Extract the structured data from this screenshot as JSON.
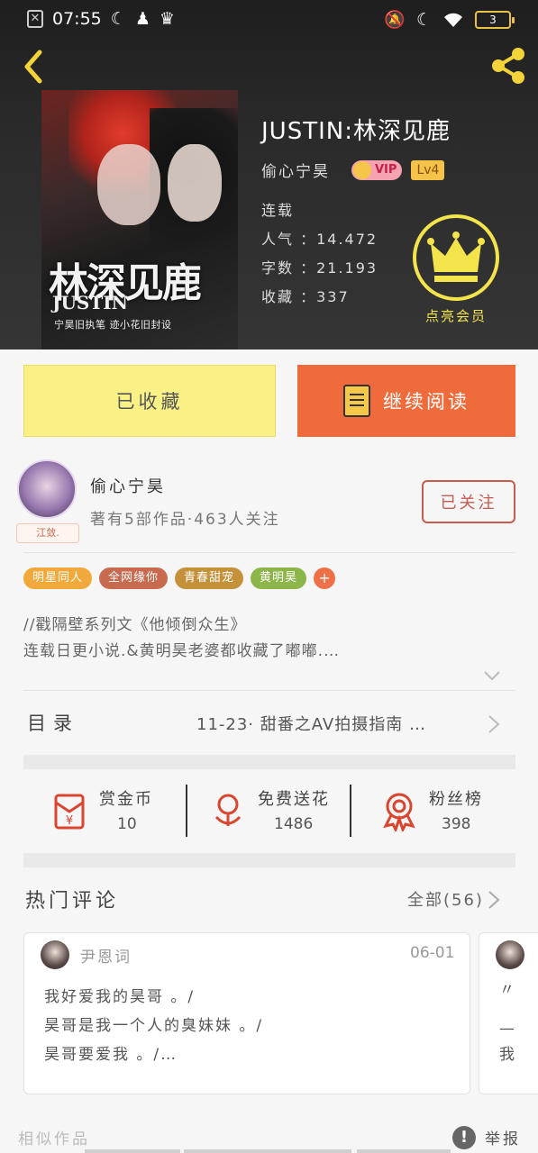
{
  "statusbar": {
    "time": "07:55",
    "battery": "3"
  },
  "book": {
    "title": "JUSTIN:林深见鹿",
    "author": "偷心宁昊",
    "vip": "VIP",
    "level": "Lv4",
    "status": "连载",
    "popularity": "人气 ：14.472",
    "word_count": "字数 ：21.193",
    "collections": "收藏 ：337",
    "cover_title": "林深见鹿",
    "cover_subtitle": "JUSTIN",
    "cover_credit": "宁昊旧执笔 迹小花旧封设",
    "member_label": "点亮会员"
  },
  "actions": {
    "collected": "已收藏",
    "continue_reading": "继续阅读"
  },
  "author_card": {
    "name": "偷心宁昊",
    "meta": "著有5部作品·463人关注",
    "avatar_tag": "江敛.",
    "follow": "已关注"
  },
  "tags": [
    {
      "label": "明星同人",
      "color": "#f0a93a"
    },
    {
      "label": "全网缘你",
      "color": "#c86a4e"
    },
    {
      "label": "青春甜宠",
      "color": "#c4913a"
    },
    {
      "label": "黄明昊",
      "color": "#8db64a"
    }
  ],
  "tag_more": "+",
  "description": {
    "line1": "//戳隔壁系列文《他倾倒众生》",
    "line2": "连载日更小说.&黄明昊老婆都收藏了嘟嘟.…"
  },
  "toc": {
    "label": "目录",
    "latest": "11-23· 甜番之AV拍摄指南 …"
  },
  "stats": {
    "reward": {
      "name": "赏金币",
      "value": "10"
    },
    "flower": {
      "name": "免费送花",
      "value": "1486"
    },
    "fans": {
      "name": "粉丝榜",
      "value": "398"
    }
  },
  "comments": {
    "title": "热门评论",
    "all": "全部(56)",
    "items": [
      {
        "user": "尹恩词",
        "date": "06-01",
        "lines": [
          "我好爱我的昊哥 。/",
          "昊哥是我一个人的臭妹妹 。/",
          "昊哥要爱我 。/…"
        ]
      },
      {
        "lines": [
          "〃",
          "—",
          "我"
        ]
      }
    ]
  },
  "footer": {
    "similar": "相似作品",
    "report_icon": "!",
    "report": "举报"
  }
}
